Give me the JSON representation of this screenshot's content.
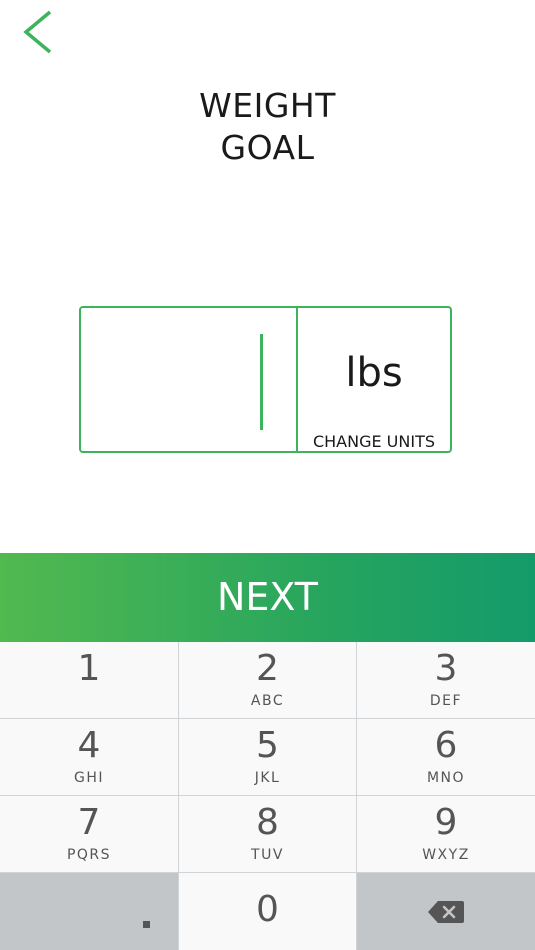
{
  "header": {
    "title_line1": "WEIGHT",
    "title_line2": "GOAL"
  },
  "weight_input": {
    "value": "",
    "unit": "lbs",
    "change_units_label": "CHANGE UNITS"
  },
  "next_button": {
    "label": "NEXT"
  },
  "keypad": {
    "keys": [
      {
        "digit": "1",
        "letters": ""
      },
      {
        "digit": "2",
        "letters": "ABC"
      },
      {
        "digit": "3",
        "letters": "DEF"
      },
      {
        "digit": "4",
        "letters": "GHI"
      },
      {
        "digit": "5",
        "letters": "JKL"
      },
      {
        "digit": "6",
        "letters": "MNO"
      },
      {
        "digit": "7",
        "letters": "PQRS"
      },
      {
        "digit": "8",
        "letters": "TUV"
      },
      {
        "digit": "9",
        "letters": "WXYZ"
      }
    ],
    "decimal_key": ".",
    "zero_key": "0"
  },
  "colors": {
    "accent_green": "#3db35c",
    "next_gradient_start": "#52b94f",
    "next_gradient_end": "#149b6a",
    "keypad_background": "#d1d4d7"
  },
  "icons": {
    "back": "chevron-left-icon",
    "backspace": "backspace-icon"
  }
}
